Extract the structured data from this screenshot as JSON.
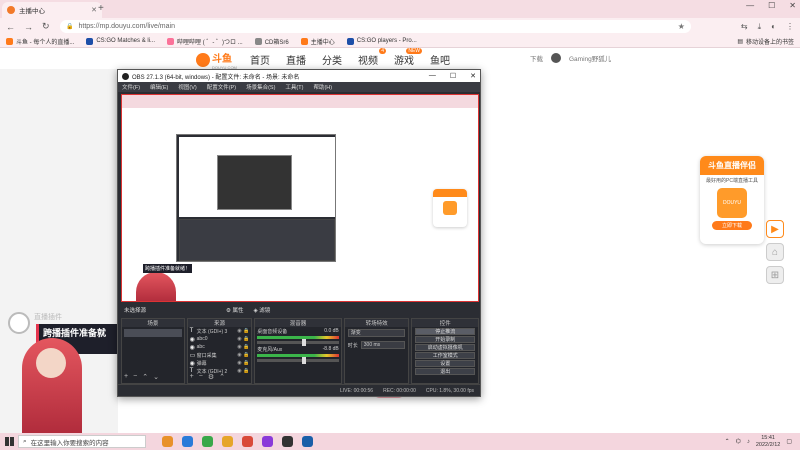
{
  "browser": {
    "tab_title": "主播中心",
    "url": "https://mp.douyu.com/live/main",
    "new_tab_glyph": "+",
    "bookmarks": [
      {
        "label": "斗鱼 - 每个人的直播...",
        "color": "#ff7a1a"
      },
      {
        "label": "CS:GO Matches & li...",
        "color": "#1d4fa8"
      },
      {
        "label": "哔哩哔哩 ( ゜- ゜)つロ ...",
        "color": "#fb7299"
      },
      {
        "label": "CD箱Sr6",
        "color": "#888888"
      },
      {
        "label": "主播中心",
        "color": "#ff7a1a"
      },
      {
        "label": "CS:GO players - Pro...",
        "color": "#1d4fa8"
      }
    ],
    "bookmarks_right": "移动设备上的书签"
  },
  "douyu": {
    "logo_text": "斗鱼",
    "logo_sub": "DOUYU.COM",
    "nav": [
      {
        "label": "首页",
        "badge": ""
      },
      {
        "label": "直播",
        "badge": ""
      },
      {
        "label": "分类",
        "badge": ""
      },
      {
        "label": "视频",
        "badge": "4"
      },
      {
        "label": "游戏",
        "badge": "NEW"
      },
      {
        "label": "鱼吧",
        "badge": ""
      }
    ],
    "download": "下载",
    "username": "Gaming野狐儿",
    "promo": {
      "title": "斗鱼直播伴侣",
      "desc": "最好用的PC端直播工具",
      "button": "立即下载",
      "logo_text": "DOUYU"
    }
  },
  "overlay": {
    "banner": "跨播插件准备就绪！",
    "faint_text": "直播插件"
  },
  "obs": {
    "title": "OBS 27.1.3 (64-bit, windows) - 配置文件: 未命名 - 场景: 未命名",
    "menu": [
      "文件(F)",
      "编辑(E)",
      "视图(V)",
      "配置文件(P)",
      "场景集合(S)",
      "工具(T)",
      "帮助(H)"
    ],
    "source_bar": {
      "label": "未选择源",
      "prop": "属性",
      "filter": "滤镜"
    },
    "docks": {
      "scenes": "场景",
      "sources": "来源",
      "mixer": "混音器",
      "transitions": "转场特效",
      "controls": "控件"
    },
    "sources": [
      {
        "icon": "T",
        "name": "文本 (GDI+) 3"
      },
      {
        "icon": "◉",
        "name": "abc0"
      },
      {
        "icon": "◉",
        "name": "abc"
      },
      {
        "icon": "▭",
        "name": "窗口采集"
      },
      {
        "icon": "◉",
        "name": "弹幕"
      },
      {
        "icon": "T",
        "name": "文本 (GDI+) 2"
      },
      {
        "icon": "T",
        "name": "文本 (GDI+)"
      }
    ],
    "mixer": [
      {
        "name": "桌面音频设备",
        "db": "0.0 dB"
      },
      {
        "name": "麦克风/Aux",
        "db": "-8.8 dB"
      }
    ],
    "transition": {
      "type": "渐变",
      "duration_label": "时长",
      "duration": "300 ms"
    },
    "controls": [
      "停止推流",
      "开始录制",
      "启动虚拟摄像机",
      "工作室模式",
      "设置",
      "退出"
    ],
    "status": [
      "LIVE: 00:00:56",
      "REC: 00:00:00",
      "CPU: 1.8%, 30.00 fps"
    ]
  },
  "taskbar": {
    "search_placeholder": "在这里输入你要搜索的内容",
    "apps": [
      "#e8912a",
      "#2a7bd9",
      "#3aa84a",
      "#e6a52a",
      "#d94a3a",
      "#8a3ad9",
      "#333333",
      "#1a5fa8"
    ],
    "time": "15:41",
    "date": "2022/2/12"
  }
}
